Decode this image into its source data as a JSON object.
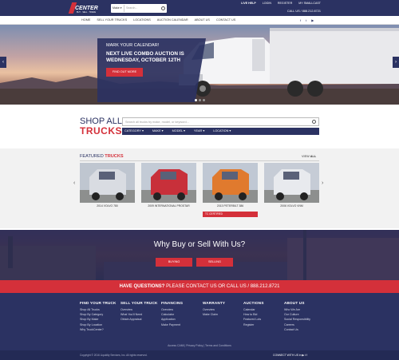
{
  "header": {
    "logo": {
      "line1": "/ TRUCK",
      "line2": "CENTER",
      "line3": "BUY · SELL · TRADE"
    },
    "search": {
      "select_value": "Make ▾",
      "placeholder": "Search..."
    },
    "top_links": [
      "LIVE HELP",
      "LOGIN",
      "REGISTER",
      "MY SMALLCAST"
    ],
    "call_us": "CALL US / 888.212.8721",
    "social_icons": [
      "facebook-icon",
      "twitter-icon",
      "youtube-icon"
    ]
  },
  "nav": {
    "items": [
      "HOME",
      "SELL YOUR TRUCKS",
      "LOCATIONS",
      "AUCTION CALENDAR",
      "ABOUT US",
      "CONTACT US"
    ]
  },
  "hero": {
    "kicker": "MARK YOUR CALENDAR!",
    "headline_1": "NEXT LIVE COMBO AUCTION IS",
    "headline_2": "WEDNESDAY, OCTOBER 12TH",
    "button": "FIND OUT MORE",
    "prev": "‹",
    "next": "›"
  },
  "shop": {
    "title_1": "SHOP ALL",
    "title_2": "TRUCKS",
    "search_placeholder": "Search all trucks by make, model, or keyword...",
    "filters": [
      "CATEGORY ▾",
      "MAKE ▾",
      "MODEL ▾",
      "YEAR ▾",
      "LOCATION ▾"
    ]
  },
  "featured": {
    "title_a": "FEATURED ",
    "title_b": "TRUCKS",
    "view_a": "VIEW ",
    "view_b": "ALL",
    "cards": [
      {
        "caption": "2014 VOLVO 780",
        "color": "#d9dce2"
      },
      {
        "caption": "2009 INTERNATIONAL PROSTAR",
        "color": "#c8303a"
      },
      {
        "caption": "2013 PETERBILT 386",
        "color": "#e07a2e",
        "badge": "TC CERTIFIED"
      },
      {
        "caption": "2006 VOLVO VNM",
        "color": "#e8eaee"
      }
    ]
  },
  "why": {
    "title": "Why Buy or Sell With Us?",
    "buying": "BUYING",
    "selling": "SELLING"
  },
  "questions": {
    "lead": "HAVE QUESTIONS?",
    "rest": " PLEASE CONTACT US OR CALL US / 888.212.8721"
  },
  "footer": {
    "columns": [
      {
        "heading": "FIND YOUR TRUCK",
        "items": [
          "Shop All Trucks",
          "Shop By Category",
          "Shop By Make",
          "Shop By Location",
          "Why TruckCenter?"
        ]
      },
      {
        "heading": "SELL YOUR TRUCK",
        "items": [
          "Overview",
          "What You'll Need",
          "Obtain Appraisal"
        ]
      },
      {
        "heading": "FINANCING",
        "items": [
          "Overview",
          "Calculator",
          "Application",
          "Make Payment"
        ]
      },
      {
        "heading": "WARRANTY",
        "items": [
          "Overview",
          "Make Claim"
        ]
      },
      {
        "heading": "AUCTIONS",
        "items": [
          "Calendar",
          "How to Bid",
          "Featured Lots",
          "Register"
        ]
      },
      {
        "heading": "ABOUT US",
        "items": [
          "Who We Are",
          "Our Culture",
          "Social Responsibility",
          "Careers",
          "Contact Us"
        ]
      }
    ],
    "legal": "Access CAMI  |  Privacy Policy  |  Terms and Conditions",
    "copyright": "Copyright © 2016 Liquidity Services, Inc. All rights reserved.",
    "connect": "CONNECT WITH US"
  },
  "colors": {
    "navy": "#2b3262",
    "red": "#d4303a"
  }
}
